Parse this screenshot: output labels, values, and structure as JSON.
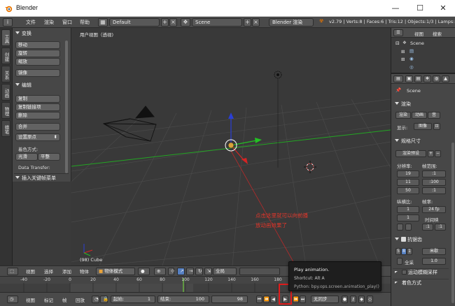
{
  "window": {
    "title": "Blender",
    "minimize": "—",
    "maximize": "☐",
    "close": "✕"
  },
  "info_header": {
    "menus": [
      "文件",
      "渲染",
      "窗口",
      "帮助"
    ],
    "layout": "Default",
    "scene": "Scene",
    "engine": "Blender 渲染",
    "stats": "v2.79 | Verts:8 | Faces:6 | Tris:12 | Objects:1/3 | Lamps:"
  },
  "tool_tabs": [
    "工具",
    "创建",
    "关系",
    "动画",
    "物理",
    "蜡笔"
  ],
  "tool_shelf": {
    "transform_title": "变换",
    "transform_buttons": [
      "移动",
      "旋转",
      "缩放",
      "镜像"
    ],
    "edit_title": "编辑",
    "edit_buttons": [
      "复制",
      "复制链接项",
      "删除",
      "合并"
    ],
    "set_origin": "设置原点",
    "shading_label": "着色方式:",
    "smooth": "光滑",
    "flat": "平整",
    "data_transfer": "Data Transfer:",
    "keyframes_panel": "插入关键帧菜单"
  },
  "viewport": {
    "view_label": "用户视图（透视)",
    "object_label": "(98) Cube",
    "annotation_line1": "点击这里就可以向前播",
    "annotation_line2": "放动画效果了"
  },
  "outliner": {
    "menus": [
      "视图",
      "搜索"
    ],
    "items": [
      "Scene",
      "",
      ""
    ]
  },
  "properties": {
    "scene_label": "Scene",
    "render_section": "渲染",
    "render_buttons": [
      "渲染",
      "动画",
      "音"
    ],
    "display_label": "显示:",
    "display_value": "图像",
    "dimensions_section": "规格尺寸",
    "render_preset": "渲染预设",
    "resolution_label": "分辨率:",
    "frame_range_label": "帧范围:",
    "res_x": "19",
    "res_y": "11",
    "res_pct": "50",
    "frame_start": ":1",
    "frame_end": ":100",
    "frame_step": ":1",
    "aspect_label": "纵横比:",
    "fps_label": "帧率:",
    "aspect_x": "1",
    "aspect_y": "1",
    "fps_value": "24 fp",
    "time_remap": "时间映",
    "aa_section": "抗锯齿",
    "aa_values": [
      "5",
      "8",
      "1"
    ],
    "aa_filter": "米歇",
    "full_sample": "全采",
    "aa_size": "1.0",
    "motion_blur": "运动模糊采样",
    "shading_section": "着色方式"
  },
  "viewport_header": {
    "menus": [
      "视图",
      "选择",
      "添加",
      "物体"
    ],
    "mode": "物体模式",
    "global": "全局"
  },
  "timeline": {
    "ticks": [
      -40,
      -20,
      0,
      20,
      40,
      60,
      80,
      100,
      120,
      140,
      160,
      180
    ],
    "current_frame_marker": 98
  },
  "timeline_header": {
    "menus": [
      "视图",
      "标记",
      "帧",
      "回放"
    ],
    "start_label": "起始:",
    "start_value": "1",
    "end_label": "结束:",
    "end_value": "100",
    "current_value": "98",
    "sync": "无同步"
  },
  "tooltip": {
    "title": "Play animation.",
    "shortcut": "Shortcut: Alt A",
    "python": "Python: bpy.ops.screen.animation_play()"
  },
  "colors": {
    "annotation": "#e0362a",
    "highlight_box": "#e01b1b",
    "grid_x_axis": "#23a623",
    "grid_y_axis": "#b82a2a"
  }
}
